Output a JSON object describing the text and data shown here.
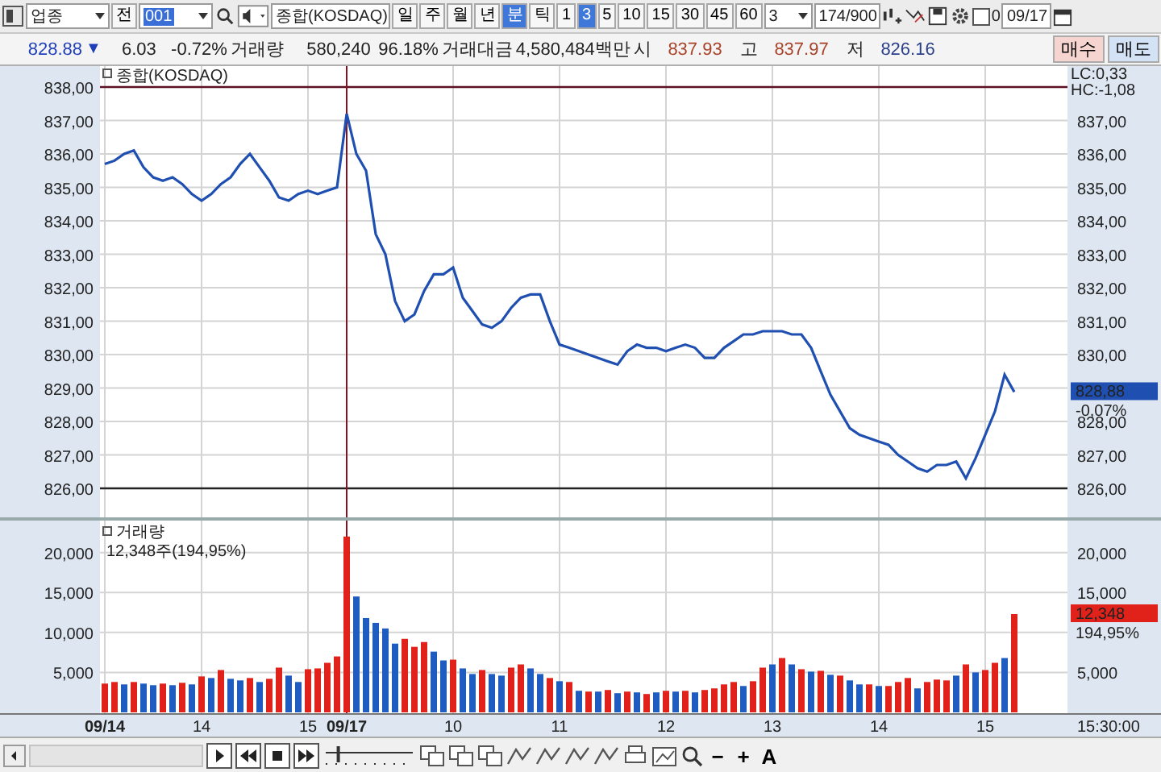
{
  "toolbar": {
    "market_select": "업종",
    "prev_button": "전",
    "code": "001",
    "name": "종합(KOSDAQ)",
    "periods": [
      {
        "label": "일",
        "selected": false
      },
      {
        "label": "주",
        "selected": false
      },
      {
        "label": "월",
        "selected": false
      },
      {
        "label": "년",
        "selected": false
      },
      {
        "label": "분",
        "selected": true
      },
      {
        "label": "틱",
        "selected": false
      }
    ],
    "intervals": [
      {
        "label": "1",
        "selected": false
      },
      {
        "label": "3",
        "selected": true
      },
      {
        "label": "5",
        "selected": false
      },
      {
        "label": "10",
        "selected": false
      },
      {
        "label": "15",
        "selected": false
      },
      {
        "label": "30",
        "selected": false
      },
      {
        "label": "45",
        "selected": false
      },
      {
        "label": "60",
        "selected": false
      }
    ],
    "interval_select": "3",
    "count": "174/900",
    "checkbox": {
      "checked": false,
      "label": "0"
    },
    "date": "09/17"
  },
  "quote": {
    "price": "828.88",
    "arrow": "▼",
    "change": "6.03",
    "rate": "-0.72%",
    "volume_label": "거래량",
    "volume": "580,240",
    "volume_rate": "96.18%",
    "value_label": "거래대금",
    "value": "4,580,484백만",
    "open_label": "시",
    "open": "837.93",
    "high_label": "고",
    "high": "837.97",
    "low_label": "저",
    "low": "826.16",
    "buy_button": "매수",
    "sell_button": "매도"
  },
  "price_pane": {
    "lc": "LC:0,33",
    "hc": "HC:-1,08",
    "right_labels": [
      "837,00",
      "836,00",
      "835,00",
      "834,00",
      "833,00",
      "832,00",
      "831,00",
      "830,00",
      "828,00",
      "827,00",
      "826,00"
    ],
    "current": "828,88",
    "current_rate": "-0,07%",
    "chart_data": {
      "type": "line",
      "categories": [
        null,
        null,
        null,
        null,
        null,
        null,
        null,
        null,
        null,
        null,
        null,
        null,
        null,
        null,
        null,
        null,
        null,
        null,
        null,
        null,
        null,
        null,
        null,
        null,
        null,
        null,
        null,
        null,
        null,
        null,
        null,
        null,
        null,
        null,
        null,
        null,
        null,
        null,
        null,
        null,
        null,
        null,
        null,
        null,
        null,
        null,
        null,
        null,
        null,
        null,
        null,
        null,
        null,
        null,
        null,
        null,
        null,
        null,
        null,
        null,
        null,
        null,
        null,
        null,
        null,
        null,
        null,
        null,
        null,
        null,
        null,
        null,
        null,
        null,
        null,
        null,
        null,
        null,
        null,
        null,
        null,
        null,
        null,
        null,
        null,
        null,
        null,
        null,
        null,
        null,
        null,
        null,
        null,
        null,
        null
      ],
      "series": [
        {
          "name": "종합(KOSDAQ)",
          "color": "#1f4fb0",
          "values": [
            835.7,
            835.8,
            836.0,
            836.1,
            835.6,
            835.3,
            835.2,
            835.3,
            835.1,
            834.8,
            834.6,
            834.8,
            835.1,
            835.3,
            835.7,
            836.0,
            835.6,
            835.2,
            834.7,
            834.6,
            834.8,
            834.9,
            834.8,
            834.9,
            835.0,
            837.2,
            836.0,
            835.5,
            833.6,
            833.0,
            831.6,
            831.0,
            831.2,
            831.9,
            832.4,
            832.4,
            832.6,
            831.7,
            831.3,
            830.9,
            830.8,
            831.0,
            831.4,
            831.7,
            831.8,
            831.8,
            831.0,
            830.3,
            830.2,
            830.1,
            830.0,
            829.9,
            829.8,
            829.7,
            830.1,
            830.3,
            830.2,
            830.2,
            830.1,
            830.2,
            830.3,
            830.2,
            829.9,
            829.9,
            830.2,
            830.4,
            830.6,
            830.6,
            830.7,
            830.7,
            830.7,
            830.6,
            830.6,
            830.2,
            829.5,
            828.8,
            828.3,
            827.8,
            827.6,
            827.5,
            827.4,
            827.3,
            827.0,
            826.8,
            826.6,
            826.5,
            826.7,
            826.7,
            826.8,
            826.3,
            826.9,
            827.6,
            828.3,
            829.4,
            828.88
          ]
        }
      ],
      "ylim": [
        826,
        838
      ],
      "yticks": [
        {
          "value": 838,
          "label": "838,00"
        },
        {
          "value": 837,
          "label": "837,00"
        },
        {
          "value": 836,
          "label": "836,00"
        },
        {
          "value": 835,
          "label": "835,00"
        },
        {
          "value": 834,
          "label": "834,00"
        },
        {
          "value": 833,
          "label": "833,00"
        },
        {
          "value": 832,
          "label": "832,00"
        },
        {
          "value": 831,
          "label": "831,00"
        },
        {
          "value": 830,
          "label": "830,00"
        },
        {
          "value": 829,
          "label": "829,00"
        },
        {
          "value": 828,
          "label": "828,00"
        },
        {
          "value": 827,
          "label": "827,00"
        },
        {
          "value": 826,
          "label": "826,00"
        }
      ],
      "grid": true
    }
  },
  "volume_pane": {
    "legend": "거래량",
    "reading": "12,348주(194,95%)",
    "right_labels": [
      "20,000",
      "15,000",
      "5,000"
    ],
    "current": "12,348",
    "current_rate": "194,95%",
    "time_end": "15:30:00",
    "chart_data": {
      "type": "bar",
      "stacked": true,
      "categories": [
        "09/14",
        null,
        null,
        null,
        null,
        null,
        null,
        null,
        null,
        null,
        "14",
        null,
        null,
        null,
        null,
        null,
        null,
        null,
        null,
        null,
        null,
        "15",
        null,
        null,
        null,
        "09/17",
        null,
        null,
        null,
        null,
        null,
        null,
        null,
        null,
        null,
        null,
        "10",
        null,
        null,
        null,
        null,
        null,
        null,
        null,
        null,
        null,
        null,
        "11",
        null,
        null,
        null,
        null,
        null,
        null,
        null,
        null,
        null,
        null,
        "12",
        null,
        null,
        null,
        null,
        null,
        null,
        null,
        null,
        null,
        null,
        "13",
        null,
        null,
        null,
        null,
        null,
        null,
        null,
        null,
        null,
        null,
        "14",
        null,
        null,
        null,
        null,
        null,
        null,
        null,
        null,
        null,
        null,
        "15",
        null,
        null,
        null
      ],
      "series": [
        {
          "color": "#e0221b",
          "values": [
            3600,
            3800,
            null,
            3800,
            null,
            null,
            3600,
            null,
            3700,
            null,
            4500,
            null,
            5300,
            null,
            null,
            4300,
            null,
            4200,
            5600,
            null,
            null,
            5400,
            5500,
            6200,
            7000,
            22000,
            null,
            null,
            null,
            null,
            null,
            9200,
            8200,
            8800,
            null,
            null,
            6600,
            null,
            null,
            5300,
            null,
            null,
            5600,
            6000,
            null,
            null,
            4300,
            null,
            3800,
            null,
            2600,
            null,
            2800,
            null,
            2600,
            null,
            2300,
            null,
            2700,
            null,
            2700,
            null,
            2800,
            3000,
            3500,
            3800,
            null,
            3900,
            5600,
            null,
            6800,
            null,
            5400,
            null,
            5200,
            null,
            4600,
            null,
            null,
            3500,
            null,
            3300,
            3800,
            4300,
            null,
            3800,
            4100,
            4000,
            null,
            6000,
            null,
            5300,
            6200,
            null,
            12300
          ]
        },
        {
          "color": "#1f5cc0",
          "values": [
            null,
            null,
            3500,
            null,
            3600,
            3400,
            null,
            3400,
            null,
            3500,
            null,
            4300,
            null,
            4200,
            4000,
            null,
            3800,
            null,
            null,
            4600,
            3800,
            null,
            null,
            null,
            null,
            null,
            14500,
            11800,
            11200,
            10500,
            8600,
            null,
            null,
            null,
            7600,
            6500,
            null,
            5500,
            4800,
            null,
            4800,
            4600,
            null,
            null,
            5500,
            4800,
            null,
            3900,
            null,
            2700,
            null,
            2600,
            null,
            2400,
            null,
            2500,
            null,
            2500,
            null,
            2600,
            null,
            2500,
            null,
            null,
            null,
            null,
            3300,
            null,
            null,
            6000,
            null,
            6000,
            null,
            5100,
            null,
            4700,
            null,
            4000,
            3500,
            null,
            3300,
            null,
            null,
            null,
            3000,
            null,
            null,
            null,
            4600,
            null,
            5000,
            null,
            null,
            6800,
            null
          ]
        }
      ],
      "ylim": [
        0,
        24000
      ],
      "yticks": [
        {
          "value": 20000,
          "label": "20,000"
        },
        {
          "value": 15000,
          "label": "15,000"
        },
        {
          "value": 10000,
          "label": "10,000"
        },
        {
          "value": 5000,
          "label": "5,000"
        }
      ],
      "grid": true,
      "ref_lines": [
        {
          "axis": "x",
          "value": "09/17"
        }
      ]
    }
  },
  "bottom_toolbar": {
    "speed_slider": {
      "level": 0.15
    },
    "buttons": [
      "−",
      "+",
      "A"
    ]
  }
}
